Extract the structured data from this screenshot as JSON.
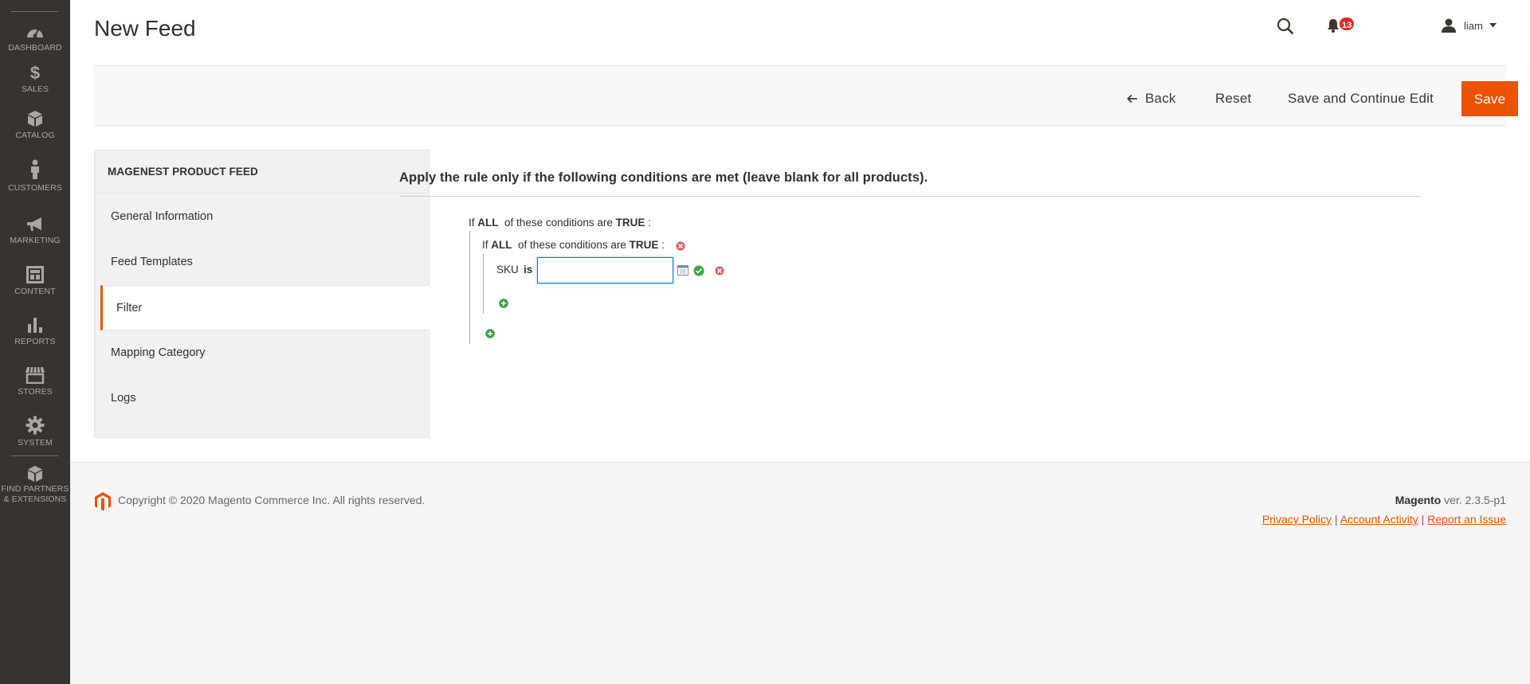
{
  "sidebar": {
    "items": [
      {
        "label": "DASHBOARD",
        "icon": "dashboard-icon"
      },
      {
        "label": "SALES",
        "icon": "dollar-icon"
      },
      {
        "label": "CATALOG",
        "icon": "box-icon"
      },
      {
        "label": "CUSTOMERS",
        "icon": "person-icon"
      },
      {
        "label": "MARKETING",
        "icon": "megaphone-icon"
      },
      {
        "label": "CONTENT",
        "icon": "layout-icon"
      },
      {
        "label": "REPORTS",
        "icon": "bar-chart-icon"
      },
      {
        "label": "STORES",
        "icon": "storefront-icon"
      },
      {
        "label": "SYSTEM",
        "icon": "gear-icon"
      }
    ],
    "partners": {
      "line1": "FIND PARTNERS",
      "line2": "& EXTENSIONS"
    }
  },
  "header": {
    "title": "New Feed",
    "notification_count": "13",
    "user_name": "liam"
  },
  "actions": {
    "back": "Back",
    "reset": "Reset",
    "save_continue": "Save and Continue Edit",
    "save": "Save"
  },
  "tabs": {
    "title": "MAGENEST PRODUCT FEED",
    "items": [
      "General Information",
      "Feed Templates",
      "Filter",
      "Mapping Category",
      "Logs"
    ],
    "active": "Filter"
  },
  "conditions": {
    "heading": "Apply the rule only if the following conditions are met (leave blank for all products).",
    "outer": {
      "if": "If",
      "agg": "ALL",
      "mid": "of these conditions are",
      "val": "TRUE",
      "colon": ":"
    },
    "inner": {
      "if": "If",
      "agg": "ALL",
      "mid": "of these conditions are",
      "val": "TRUE",
      "colon": ":"
    },
    "row": {
      "attribute": "SKU",
      "operator": "is",
      "value": ""
    }
  },
  "footer": {
    "copyright": "Copyright © 2020 Magento Commerce Inc. All rights reserved.",
    "brand": "Magento",
    "version": "ver. 2.3.5-p1",
    "links": [
      "Privacy Policy",
      "Account Activity",
      "Report an Issue"
    ],
    "link_sep": "|"
  },
  "colors": {
    "accent": "#eb5202",
    "sidebar_bg": "#373330",
    "focus": "#007bdb"
  }
}
